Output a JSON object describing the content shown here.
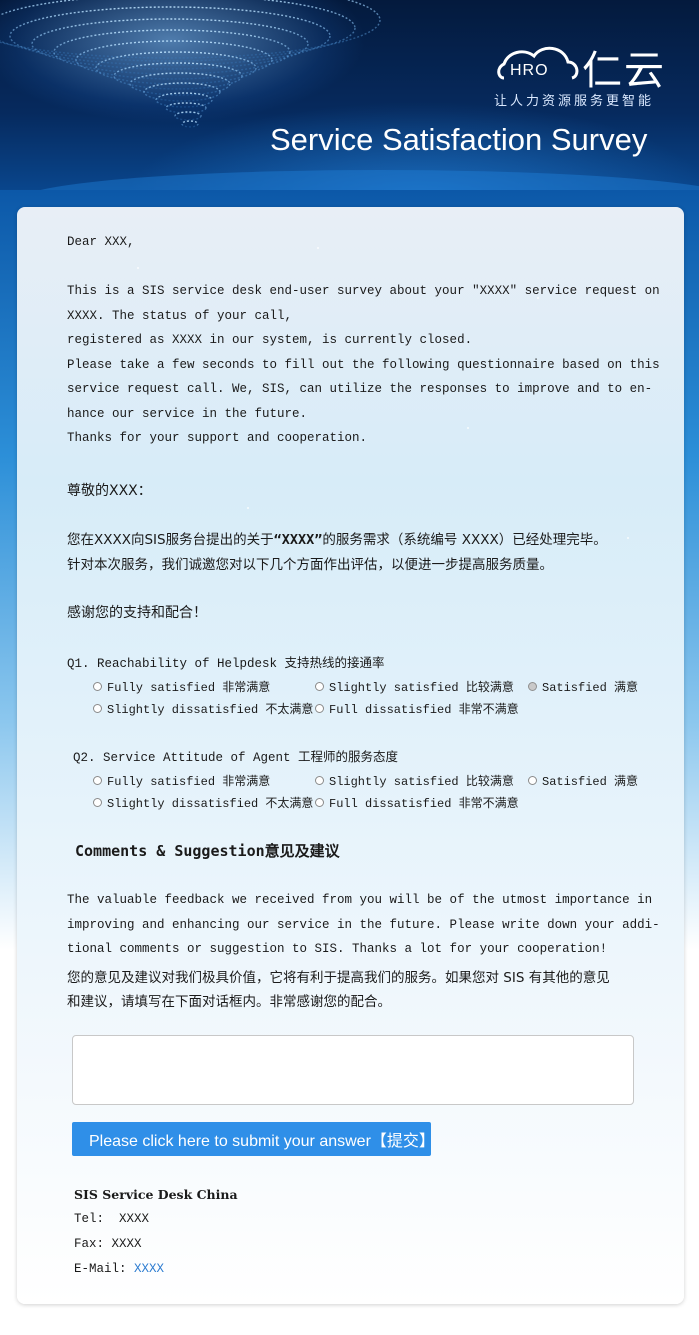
{
  "header": {
    "logo_text": "HRO",
    "logo_cn": "仁云",
    "slogan": "让人力资源服务更智能",
    "title": "Service Satisfaction Survey"
  },
  "letter_en": {
    "greeting": "Dear XXX,",
    "lines": [
      "This is a SIS service desk end-user survey about your \"XXXX\" service request on",
      "XXXX. The status of your call,",
      "registered as XXXX in our system, is currently closed.",
      "Please take a few seconds to fill out the following questionnaire based on this",
      "service request call. We, SIS, can utilize the responses to improve and to en-",
      "hance our service in the future.",
      "Thanks for your support and cooperation."
    ]
  },
  "letter_cn": {
    "greeting": "尊敬的XXX：",
    "line1_prefix": "您在XXXX向SIS服务台提出的关于",
    "line1_quote": "“XXXX”",
    "line1_suffix": "的服务需求（系统编号 XXXX）已经处理完毕。",
    "line2": "针对本次服务，我们诚邀您对以下几个方面作出评估，以便进一步提高服务质量。",
    "thanks": "感谢您的支持和配合！"
  },
  "questions": [
    {
      "label": "Q1. Reachability of Helpdesk 支持热线的接通率",
      "options": [
        {
          "label": "Fully satisfied 非常满意",
          "selected": false
        },
        {
          "label": "Slightly satisfied 比较满意",
          "selected": false
        },
        {
          "label": "Satisfied 满意",
          "selected": true
        },
        {
          "label": "Slightly dissatisfied 不太满意",
          "selected": false
        },
        {
          "label": "Full dissatisfied 非常不满意",
          "selected": false
        }
      ]
    },
    {
      "label": "Q2. Service Attitude of Agent 工程师的服务态度",
      "options": [
        {
          "label": "Fully satisfied 非常满意",
          "selected": false
        },
        {
          "label": "Slightly satisfied 比较满意",
          "selected": false
        },
        {
          "label": "Satisfied 满意",
          "selected": false
        },
        {
          "label": "Slightly dissatisfied 不太满意",
          "selected": false
        },
        {
          "label": "Full dissatisfied 非常不满意",
          "selected": false
        }
      ]
    }
  ],
  "comments": {
    "heading": "Comments & Suggestion意见及建议",
    "en_lines": [
      "The valuable feedback we received from you will be of the utmost importance in",
      "improving and enhancing our service in the future. Please write down your addi-",
      "tional comments or suggestion to SIS. Thanks a lot for your cooperation!"
    ],
    "cn_lines": [
      "您的意见及建议对我们极具价值，它将有利于提高我们的服务。如果您对 SIS 有其他的意见",
      "和建议，请填写在下面对话框内。非常感谢您的配合。"
    ],
    "textarea_value": "",
    "submit_label": "Please click here to submit your answer【提交】"
  },
  "footer": {
    "title": "SIS Service Desk China",
    "tel_label": "Tel:",
    "tel_value": "XXXX",
    "fax_label": "Fax:",
    "fax_value": "XXXX",
    "email_label": "E-Mail:",
    "email_value": "XXXX"
  },
  "colors": {
    "accent": "#2f8fe8",
    "link": "#2b7bd0",
    "banner_dark": "#041a3d"
  }
}
